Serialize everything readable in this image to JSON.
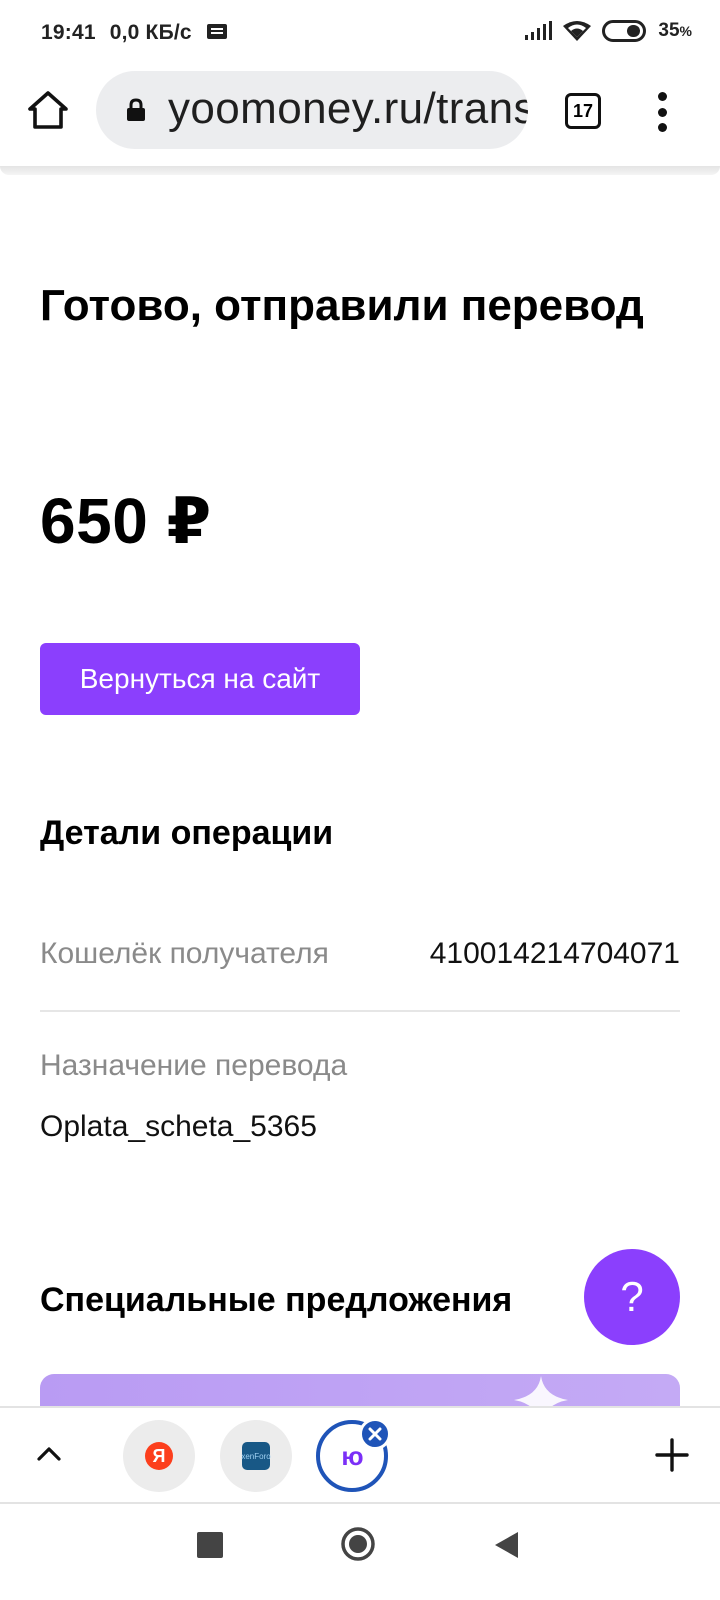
{
  "status_bar": {
    "time": "19:41",
    "net_speed": "0,0 КБ/с",
    "battery": "35",
    "battery_unit": "%"
  },
  "browser": {
    "url": "yoomoney.ru/transfer/process/success",
    "tab_count": "17"
  },
  "page": {
    "title": "Готово, отправили перевод",
    "amount": "650 ₽",
    "back_button": "Вернуться на сайт",
    "details_title": "Детали операции",
    "details": [
      {
        "label": "Кошелёк получателя",
        "value": "410014214704071"
      },
      {
        "label": "Назначение перевода",
        "value": "Oplata_scheta_5365"
      }
    ],
    "offers_title": "Специальные предложения",
    "help_label": "?"
  },
  "tab_strip": {
    "tabs": [
      {
        "logo": "Я",
        "icon": "yandex-icon"
      },
      {
        "logo": "xenForo",
        "icon": "xenforo-icon"
      },
      {
        "logo": "ю",
        "icon": "yoomoney-icon",
        "active": true
      }
    ]
  },
  "colors": {
    "accent": "#8b3ffd",
    "tab_active_ring": "#1f54b8"
  }
}
